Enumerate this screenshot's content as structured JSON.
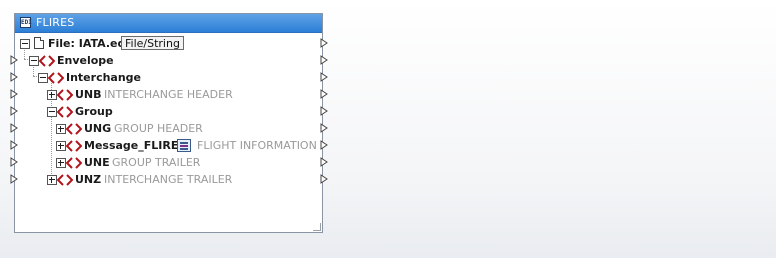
{
  "component": {
    "title": "FLIRES",
    "title_icon_text": "EDI"
  },
  "tree": [
    {
      "key": "file",
      "label": "File: IATA.edi",
      "button": "File/String"
    },
    {
      "key": "envelope",
      "label": "Envelope"
    },
    {
      "key": "interchange",
      "label": "Interchange"
    },
    {
      "key": "unb",
      "label": "UNB",
      "desc": "INTERCHANGE HEADER"
    },
    {
      "key": "group",
      "label": "Group"
    },
    {
      "key": "ung",
      "label": "UNG",
      "desc": "GROUP HEADER"
    },
    {
      "key": "message",
      "label": "Message_FLIRES",
      "desc": "FLIGHT INFORMATION R"
    },
    {
      "key": "une",
      "label": "UNE",
      "desc": "GROUP TRAILER"
    },
    {
      "key": "unz",
      "label": "UNZ",
      "desc": "INTERCHANGE TRAILER"
    }
  ],
  "colors": {
    "title_bar": "#2c7fd7",
    "element_icon": "#b1151b",
    "description_text": "#9a9a9a"
  }
}
